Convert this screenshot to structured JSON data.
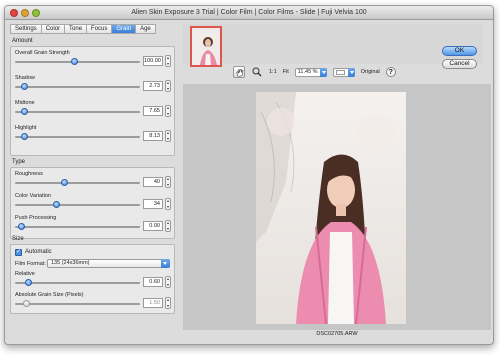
{
  "window": {
    "title": "Alien Skin Exposure 3 Trial | Color Film | Color Films - Slide | Fuji Velvia 100"
  },
  "tabs": [
    "Settings",
    "Color",
    "Tone",
    "Focus",
    "Grain",
    "Age"
  ],
  "active_tab": "Grain",
  "amount": {
    "title": "Amount",
    "params": [
      {
        "label": "Overall Grain Strength",
        "value": "100.00",
        "fraction": 0.45
      },
      {
        "label": "Shadow",
        "value": "2.73",
        "fraction": 0.05
      },
      {
        "label": "Midtone",
        "value": "7.65",
        "fraction": 0.05
      },
      {
        "label": "Highlight",
        "value": "8.13",
        "fraction": 0.05
      }
    ]
  },
  "type": {
    "title": "Type",
    "params": [
      {
        "label": "Roughness",
        "value": "40",
        "fraction": 0.37
      },
      {
        "label": "Color Variation",
        "value": "34",
        "fraction": 0.3
      },
      {
        "label": "Push Processing",
        "value": "0.00",
        "fraction": 0.02
      }
    ]
  },
  "size": {
    "title": "Size",
    "automatic_label": "Automatic",
    "film_format_label": "Film Format:",
    "film_format_value": "135 (24x36mm)",
    "relative": {
      "label": "Relative",
      "value": "0.60",
      "fraction": 0.08
    },
    "absolute": {
      "label": "Absolute Grain Size (Pixels)",
      "value": "1.50",
      "fraction": 0.06
    }
  },
  "toolbar": {
    "one_to_one": "1:1",
    "fit": "Fit",
    "zoom_value": "11.45 %",
    "original": "Original",
    "help": "?"
  },
  "buttons": {
    "ok": "OK",
    "cancel": "Cancel"
  },
  "preview": {
    "filename": "DSC02705.ARW"
  },
  "colors": {
    "accent": "#3a7fd6",
    "thumb_border": "#e0554b"
  }
}
